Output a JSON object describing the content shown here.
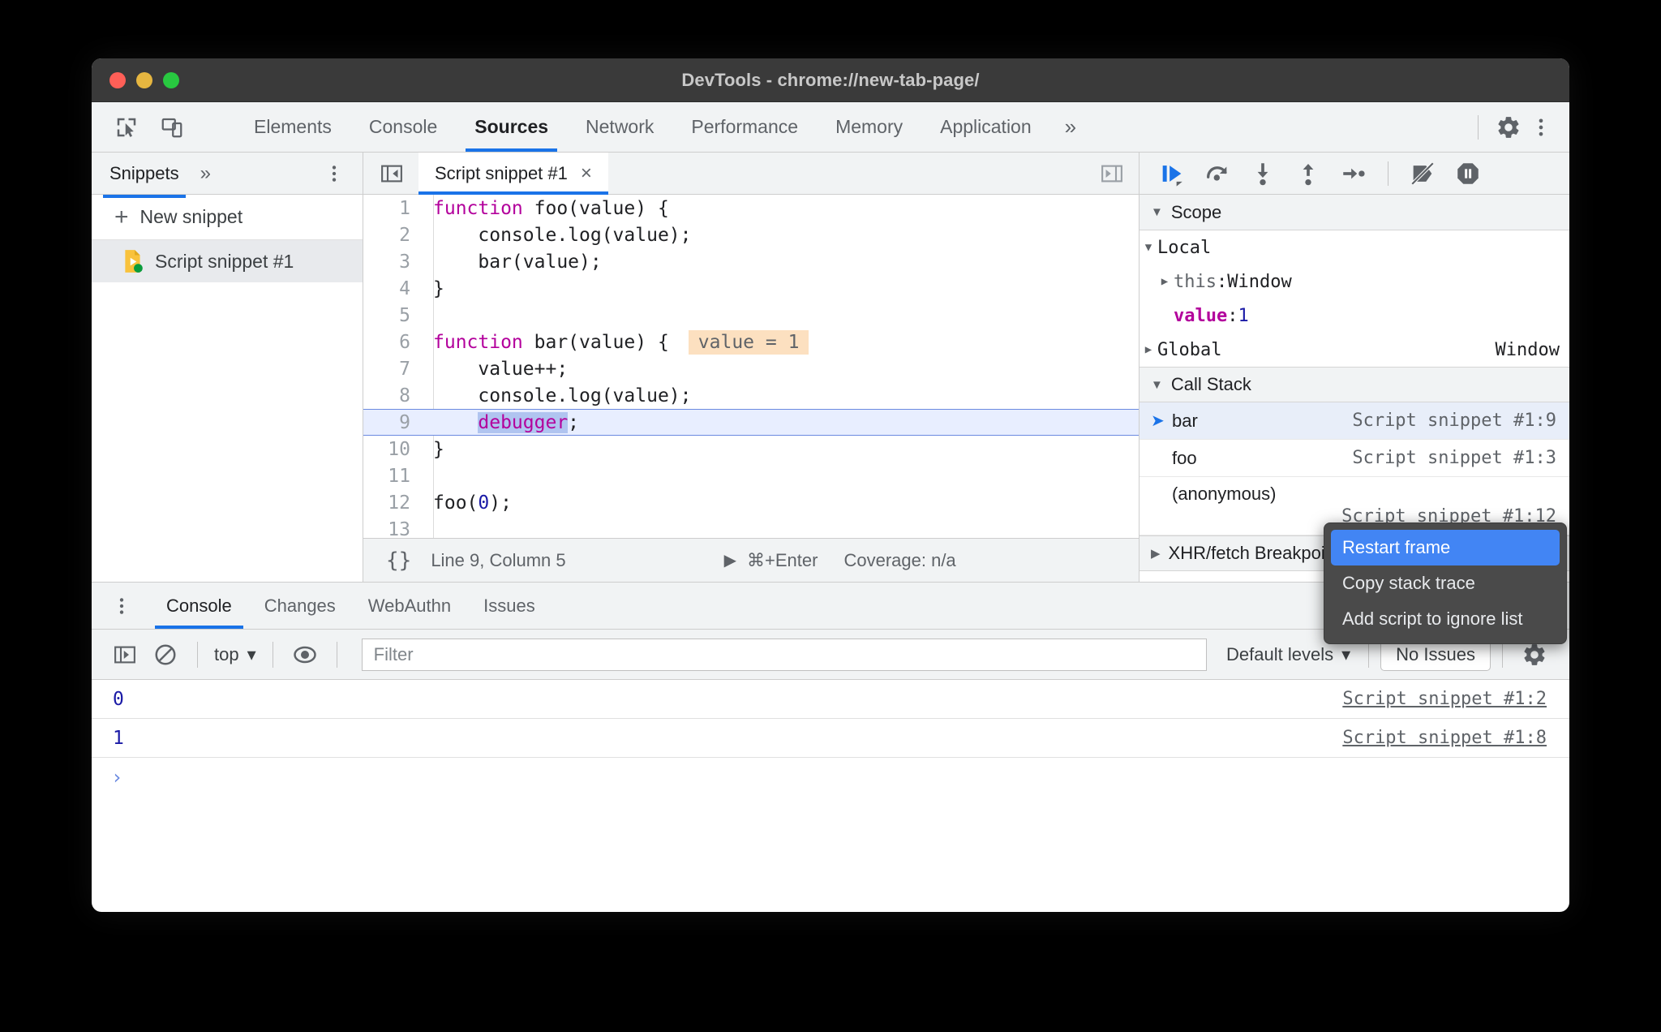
{
  "window": {
    "title": "DevTools - chrome://new-tab-page/",
    "traffic_lights": [
      "close",
      "minimize",
      "maximize"
    ]
  },
  "panel_tabs": {
    "items": [
      {
        "label": "Elements",
        "active": false
      },
      {
        "label": "Console",
        "active": false
      },
      {
        "label": "Sources",
        "active": true
      },
      {
        "label": "Network",
        "active": false
      },
      {
        "label": "Performance",
        "active": false
      },
      {
        "label": "Memory",
        "active": false
      },
      {
        "label": "Application",
        "active": false
      }
    ],
    "more_label": "»",
    "left_icons": [
      "inspect-element-icon",
      "device-toolbar-icon"
    ],
    "right_icons": [
      "settings-gear-icon",
      "more-options-icon"
    ]
  },
  "navigator": {
    "title": "Snippets",
    "more_tabs_label": "»",
    "more_options_icon": "more-options-icon",
    "new_snippet_label": "New snippet",
    "new_snippet_plus": "+",
    "snippet_name": "Script snippet #1"
  },
  "editor": {
    "collapse_icon": "collapse-sidebar-icon",
    "expand_icon": "expand-sidebar-icon",
    "tab_label": "Script snippet #1",
    "close_label": "×",
    "lines": [
      {
        "n": "1",
        "segments": [
          {
            "t": "function ",
            "c": "kw"
          },
          {
            "t": "foo(value) {",
            "c": ""
          }
        ]
      },
      {
        "n": "2",
        "segments": [
          {
            "t": "    console.log(value);",
            "c": ""
          }
        ]
      },
      {
        "n": "3",
        "segments": [
          {
            "t": "    bar(value);",
            "c": ""
          }
        ]
      },
      {
        "n": "4",
        "segments": [
          {
            "t": "}",
            "c": ""
          }
        ]
      },
      {
        "n": "5",
        "segments": [
          {
            "t": "",
            "c": ""
          }
        ]
      },
      {
        "n": "6",
        "segments": [
          {
            "t": "function ",
            "c": "kw"
          },
          {
            "t": "bar(value) {",
            "c": ""
          }
        ],
        "inline_value": "value = 1"
      },
      {
        "n": "7",
        "segments": [
          {
            "t": "    value++;",
            "c": ""
          }
        ]
      },
      {
        "n": "8",
        "segments": [
          {
            "t": "    console.log(value);",
            "c": ""
          }
        ]
      },
      {
        "n": "9",
        "segments": [
          {
            "t": "    ",
            "c": ""
          },
          {
            "t": "debugger",
            "c": "dbg"
          },
          {
            "t": ";",
            "c": ""
          }
        ],
        "current": true
      },
      {
        "n": "10",
        "segments": [
          {
            "t": "}",
            "c": ""
          }
        ]
      },
      {
        "n": "11",
        "segments": [
          {
            "t": "",
            "c": ""
          }
        ]
      },
      {
        "n": "12",
        "segments": [
          {
            "t": "foo(",
            "c": ""
          },
          {
            "t": "0",
            "c": "num"
          },
          {
            "t": ");",
            "c": ""
          }
        ]
      },
      {
        "n": "13",
        "segments": [
          {
            "t": "",
            "c": ""
          }
        ]
      }
    ],
    "status_bar": {
      "pretty_print_label": "{}",
      "position": "Line 9, Column 5",
      "run_shortcut": "⌘+Enter",
      "coverage": "Coverage: n/a"
    }
  },
  "debugger": {
    "toolbar_icons": [
      "resume-script-execution-icon",
      "step-over-next-function-call-icon",
      "step-into-next-function-call-icon",
      "step-out-of-current-function-icon",
      "step-icon",
      "deactivate-breakpoints-icon",
      "pause-on-exceptions-icon"
    ],
    "scope": {
      "title": "Scope",
      "groups": [
        {
          "name": "Local",
          "expanded": true,
          "rows": [
            {
              "expandable": true,
              "name": "this",
              "separator": ": ",
              "value": "Window",
              "value_kind": "object"
            },
            {
              "expandable": false,
              "name": "value",
              "separator": ": ",
              "value": "1",
              "value_kind": "number"
            }
          ]
        },
        {
          "name": "Global",
          "expanded": false,
          "right_value": "Window"
        }
      ]
    },
    "call_stack": {
      "title": "Call Stack",
      "frames": [
        {
          "name": "bar",
          "location": "Script snippet #1:9",
          "selected": true
        },
        {
          "name": "foo",
          "location": "Script snippet #1:3",
          "selected": false
        },
        {
          "name": "(anonymous)",
          "location": "Script snippet #1:12",
          "selected": false
        }
      ]
    },
    "next_section": "XHR/fetch Breakpoints"
  },
  "context_menu": {
    "items": [
      {
        "label": "Restart frame",
        "highlighted": true
      },
      {
        "label": "Copy stack trace",
        "highlighted": false
      },
      {
        "label": "Add script to ignore list",
        "highlighted": false
      }
    ]
  },
  "drawer": {
    "more_icon": "more-options-icon",
    "tabs": [
      {
        "label": "Console",
        "active": true
      },
      {
        "label": "Changes",
        "active": false
      },
      {
        "label": "WebAuthn",
        "active": false
      },
      {
        "label": "Issues",
        "active": false
      }
    ],
    "close_label": "✕",
    "console_toolbar": {
      "sidebar_icon": "console-sidebar-icon",
      "clear_icon": "clear-console-icon",
      "context_selector": "top",
      "context_caret": "▾",
      "eye_icon": "live-expression-icon",
      "filter_placeholder": "Filter",
      "filter_value": "",
      "levels_label": "Default levels",
      "levels_caret": "▾",
      "issues_label": "No Issues",
      "settings_icon": "settings-gear-icon"
    },
    "console_logs": [
      {
        "value": "0",
        "source": "Script snippet #1:2"
      },
      {
        "value": "1",
        "source": "Script snippet #1:8"
      }
    ],
    "prompt_symbol": "›"
  },
  "colors": {
    "accent_blue": "#1a73e8",
    "titlebar_bg": "#3a3a3a",
    "toolbar_bg": "#f1f3f4",
    "keyword_purple": "#b3009c",
    "number_blue": "#1a1aa6",
    "inline_value_bg": "#fce0c0",
    "current_line_bg": "#e8eeff",
    "menu_bg": "#4a4a4a",
    "menu_highlight": "#4285f4"
  }
}
